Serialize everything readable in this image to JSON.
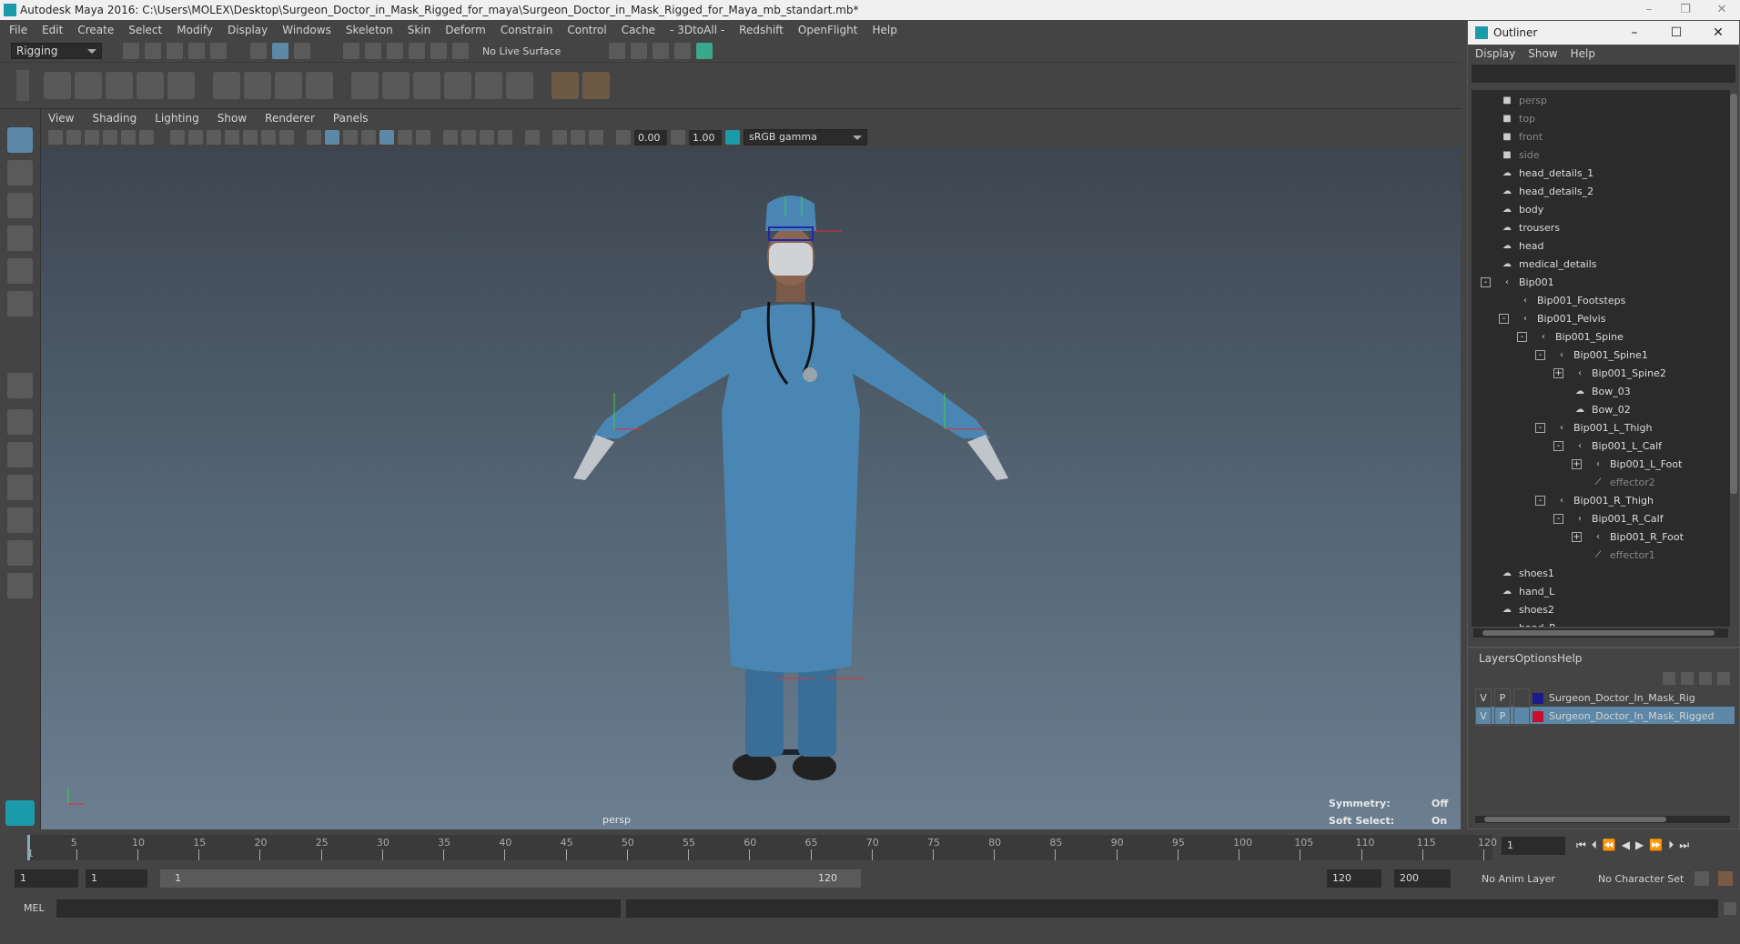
{
  "window": {
    "title": "Autodesk Maya 2016: C:\\Users\\MOLEX\\Desktop\\Surgeon_Doctor_in_Mask_Rigged_for_maya\\Surgeon_Doctor_in_Mask_Rigged_for_Maya_mb_standart.mb*"
  },
  "menubar": [
    "File",
    "Edit",
    "Create",
    "Select",
    "Modify",
    "Display",
    "Windows",
    "Skeleton",
    "Skin",
    "Deform",
    "Constrain",
    "Control",
    "Cache",
    "- 3DtoAll -",
    "Redshift",
    "OpenFlight",
    "Help"
  ],
  "statusline": {
    "menuset": "Rigging",
    "live_surface": "No Live Surface"
  },
  "panel": {
    "menus": [
      "View",
      "Shading",
      "Lighting",
      "Show",
      "Renderer",
      "Panels"
    ],
    "exposure": "0.00",
    "gamma": "1.00",
    "colorspace": "sRGB gamma"
  },
  "viewport": {
    "camera": "persp",
    "symmetry_label": "Symmetry:",
    "symmetry_value": "Off",
    "soft_select_label": "Soft Select:",
    "soft_select_value": "On"
  },
  "outliner": {
    "title": "Outliner",
    "menus": [
      "Display",
      "Show",
      "Help"
    ],
    "items": [
      {
        "label": "persp",
        "depth": 0,
        "kind": "camera",
        "dim": true
      },
      {
        "label": "top",
        "depth": 0,
        "kind": "camera",
        "dim": true
      },
      {
        "label": "front",
        "depth": 0,
        "kind": "camera",
        "dim": true
      },
      {
        "label": "side",
        "depth": 0,
        "kind": "camera",
        "dim": true
      },
      {
        "label": "head_details_1",
        "depth": 0,
        "kind": "mesh"
      },
      {
        "label": "head_details_2",
        "depth": 0,
        "kind": "mesh"
      },
      {
        "label": "body",
        "depth": 0,
        "kind": "mesh"
      },
      {
        "label": "trousers",
        "depth": 0,
        "kind": "mesh"
      },
      {
        "label": "head",
        "depth": 0,
        "kind": "mesh"
      },
      {
        "label": "medical_details",
        "depth": 0,
        "kind": "mesh"
      },
      {
        "label": "Bip001",
        "depth": 0,
        "kind": "joint",
        "exp": "-"
      },
      {
        "label": "Bip001_Footsteps",
        "depth": 1,
        "kind": "joint"
      },
      {
        "label": "Bip001_Pelvis",
        "depth": 1,
        "kind": "joint",
        "exp": "-"
      },
      {
        "label": "Bip001_Spine",
        "depth": 2,
        "kind": "joint",
        "exp": "-"
      },
      {
        "label": "Bip001_Spine1",
        "depth": 3,
        "kind": "joint",
        "exp": "-"
      },
      {
        "label": "Bip001_Spine2",
        "depth": 4,
        "kind": "joint",
        "exp": "+"
      },
      {
        "label": "Bow_03",
        "depth": 4,
        "kind": "mesh"
      },
      {
        "label": "Bow_02",
        "depth": 4,
        "kind": "mesh"
      },
      {
        "label": "Bip001_L_Thigh",
        "depth": 3,
        "kind": "joint",
        "exp": "-"
      },
      {
        "label": "Bip001_L_Calf",
        "depth": 4,
        "kind": "joint",
        "exp": "-"
      },
      {
        "label": "Bip001_L_Foot",
        "depth": 5,
        "kind": "joint",
        "exp": "+"
      },
      {
        "label": "effector2",
        "depth": 5,
        "kind": "effector",
        "dim": true
      },
      {
        "label": "Bip001_R_Thigh",
        "depth": 3,
        "kind": "joint",
        "exp": "-"
      },
      {
        "label": "Bip001_R_Calf",
        "depth": 4,
        "kind": "joint",
        "exp": "-"
      },
      {
        "label": "Bip001_R_Foot",
        "depth": 5,
        "kind": "joint",
        "exp": "+"
      },
      {
        "label": "effector1",
        "depth": 5,
        "kind": "effector",
        "dim": true
      },
      {
        "label": "shoes1",
        "depth": 0,
        "kind": "mesh"
      },
      {
        "label": "hand_L",
        "depth": 0,
        "kind": "mesh"
      },
      {
        "label": "shoes2",
        "depth": 0,
        "kind": "mesh"
      },
      {
        "label": "hand_R",
        "depth": 0,
        "kind": "mesh"
      }
    ]
  },
  "layers": {
    "menus": [
      "Layers",
      "Options",
      "Help"
    ],
    "rows": [
      {
        "v": "V",
        "p": "P",
        "name": "Surgeon_Doctor_In_Mask_Rig",
        "color": "#1a1a8c",
        "selected": false
      },
      {
        "v": "V",
        "p": "P",
        "name": "Surgeon_Doctor_In_Mask_Rigged",
        "color": "#c8102e",
        "selected": true
      }
    ]
  },
  "timeline": {
    "ticks": [
      "5",
      "10",
      "15",
      "20",
      "25",
      "30",
      "35",
      "40",
      "45",
      "50",
      "55",
      "60",
      "65",
      "70",
      "75",
      "80",
      "85",
      "90",
      "95",
      "100",
      "105",
      "110",
      "115",
      "120"
    ],
    "first": "1",
    "current_frame": "1"
  },
  "range": {
    "start": "1",
    "playback_start": "1",
    "slider_start": "1",
    "slider_end": "120",
    "playback_end": "120",
    "end": "200",
    "anim_layer": "No Anim Layer",
    "char_set": "No Character Set"
  },
  "cmd": {
    "lang": "MEL"
  }
}
